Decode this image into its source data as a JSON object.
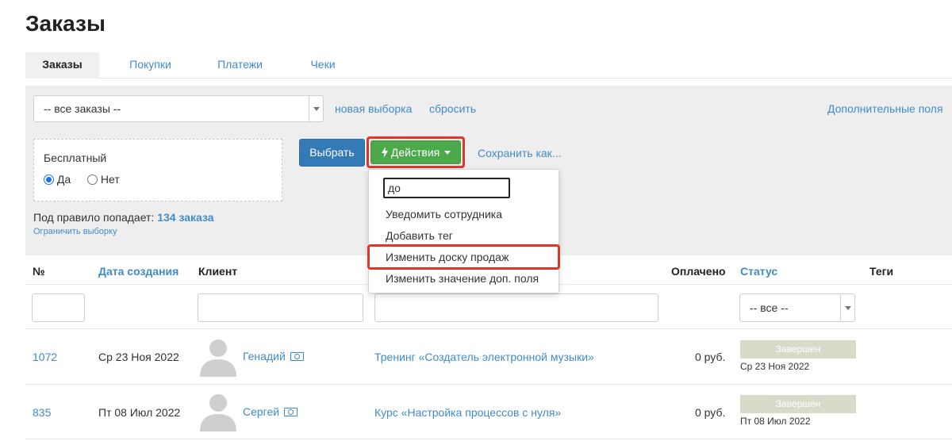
{
  "page": {
    "title": "Заказы"
  },
  "tabs": [
    {
      "label": "Заказы",
      "active": true
    },
    {
      "label": "Покупки",
      "active": false
    },
    {
      "label": "Платежи",
      "active": false
    },
    {
      "label": "Чеки",
      "active": false
    }
  ],
  "filter": {
    "selection_value": "-- все заказы --",
    "new_selection": "новая выборка",
    "reset": "сбросить",
    "extra_fields": "Дополнительные поля",
    "free_label": "Бесплатный",
    "radio_yes": "Да",
    "radio_no": "Нет",
    "radio_selected": "Да",
    "rule_prefix": "Под правило попадает:",
    "rule_count": "134 заказа",
    "limit_link": "Ограничить выборку"
  },
  "actions": {
    "select_button": "Выбрать",
    "actions_button": "Действия",
    "save_as": "Сохранить как...",
    "search_value": "до",
    "items": [
      "Уведомить сотрудника",
      "Добавить тег",
      "Изменить доску продаж",
      "Изменить значение доп. поля"
    ]
  },
  "table": {
    "headers": {
      "number": "№",
      "created": "Дата создания",
      "client": "Клиент",
      "paid": "Оплачено",
      "status": "Статус",
      "tags": "Теги"
    },
    "status_filter": "-- все --",
    "rows": [
      {
        "id": "1072",
        "date": "Ср 23 Ноя 2022",
        "client": "Генадий",
        "product": "Тренинг «Создатель электронной музыки»",
        "paid": "0 руб.",
        "status": "Завершен",
        "status_date": "Ср 23 Ноя 2022"
      },
      {
        "id": "835",
        "date": "Пт 08 Июл 2022",
        "client": "Сергей",
        "product": "Курс «Настройка процессов с нуля»",
        "paid": "0 руб.",
        "status": "Завершен",
        "status_date": "Пт 08 Июл 2022"
      }
    ]
  },
  "colors": {
    "accent": "#428bca",
    "success": "#4caa4c",
    "highlight": "#e0352b",
    "status_badge": "#d9dbca"
  }
}
